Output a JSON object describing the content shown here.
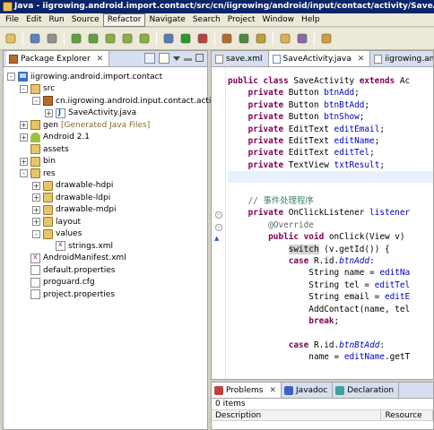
{
  "window": {
    "title": "Java - iigrowing.android.import.contact/src/cn/iigrowing/android/input/contact/activity/SaveActivity.java"
  },
  "menu": [
    "File",
    "Edit",
    "Run",
    "Source",
    "Refactor",
    "Navigate",
    "Search",
    "Project",
    "Window",
    "Help"
  ],
  "toolbar_icons": [
    "new-icon",
    "save-icon",
    "print-icon",
    "sdk-manager-icon",
    "avd-manager-icon",
    "android-project-icon",
    "android-test-icon",
    "android-xml-icon",
    "debug-icon",
    "run-icon",
    "external-tools-icon",
    "new-java-package-icon",
    "new-java-class-icon",
    "open-type-icon",
    "search-icon",
    "annotation-icon",
    "perspective-icon"
  ],
  "package_explorer": {
    "title": "Package Explorer",
    "items": [
      {
        "label": "iigrowing.android.import.contact",
        "icon": "project-icon",
        "indent": 0,
        "toggle": "-"
      },
      {
        "label": "src",
        "icon": "source-folder-icon",
        "indent": 1,
        "toggle": "-"
      },
      {
        "label": "cn.iigrowing.android.input.contact.activity",
        "icon": "package-icon",
        "indent": 2,
        "toggle": "-"
      },
      {
        "label": "SaveActivity.java",
        "icon": "java-file-icon",
        "indent": 3,
        "toggle": "+"
      },
      {
        "label": "gen",
        "icon": "source-folder-icon",
        "indent": 1,
        "toggle": "+",
        "suffix": "[Generated Java Files]"
      },
      {
        "label": "Android 2.1",
        "icon": "android-library-icon",
        "indent": 1,
        "toggle": "+"
      },
      {
        "label": "assets",
        "icon": "folder-icon",
        "indent": 1,
        "toggle": ""
      },
      {
        "label": "bin",
        "icon": "folder-icon",
        "indent": 1,
        "toggle": "+"
      },
      {
        "label": "res",
        "icon": "folder-icon",
        "indent": 1,
        "toggle": "-"
      },
      {
        "label": "drawable-hdpi",
        "icon": "folder-icon",
        "indent": 2,
        "toggle": "+"
      },
      {
        "label": "drawable-ldpi",
        "icon": "folder-icon",
        "indent": 2,
        "toggle": "+"
      },
      {
        "label": "drawable-mdpi",
        "icon": "folder-icon",
        "indent": 2,
        "toggle": "+"
      },
      {
        "label": "layout",
        "icon": "folder-icon",
        "indent": 2,
        "toggle": "+"
      },
      {
        "label": "values",
        "icon": "folder-icon",
        "indent": 2,
        "toggle": "-"
      },
      {
        "label": "strings.xml",
        "icon": "xml-file-icon",
        "indent": 3,
        "toggle": ""
      },
      {
        "label": "AndroidManifest.xml",
        "icon": "xml-file-icon",
        "indent": 1,
        "toggle": ""
      },
      {
        "label": "default.properties",
        "icon": "file-icon",
        "indent": 1,
        "toggle": ""
      },
      {
        "label": "proguard.cfg",
        "icon": "file-icon",
        "indent": 1,
        "toggle": ""
      },
      {
        "label": "project.properties",
        "icon": "file-icon",
        "indent": 1,
        "toggle": ""
      }
    ]
  },
  "editor": {
    "tabs": [
      {
        "label": "save.xml",
        "active": false
      },
      {
        "label": "SaveActivity.java",
        "active": true
      },
      {
        "label": "iigrowing.androi",
        "active": false
      }
    ],
    "code_lines": [
      [
        [
          "kw",
          "public class "
        ],
        [
          "t",
          "SaveActivity "
        ],
        [
          "kw",
          "extends "
        ],
        [
          "t",
          "Ac"
        ]
      ],
      [
        [
          "t",
          "    "
        ],
        [
          "kw",
          "private "
        ],
        [
          "t",
          "Button "
        ],
        [
          "fld",
          "btnAdd"
        ],
        [
          "t",
          ";"
        ]
      ],
      [
        [
          "t",
          "    "
        ],
        [
          "kw",
          "private "
        ],
        [
          "t",
          "Button "
        ],
        [
          "fld",
          "btnBtAdd"
        ],
        [
          "t",
          ";"
        ]
      ],
      [
        [
          "t",
          "    "
        ],
        [
          "kw",
          "private "
        ],
        [
          "t",
          "Button "
        ],
        [
          "fld",
          "btnShow"
        ],
        [
          "t",
          ";"
        ]
      ],
      [
        [
          "t",
          "    "
        ],
        [
          "kw",
          "private "
        ],
        [
          "t",
          "EditText "
        ],
        [
          "fld",
          "editEmail"
        ],
        [
          "t",
          ";"
        ]
      ],
      [
        [
          "t",
          "    "
        ],
        [
          "kw",
          "private "
        ],
        [
          "t",
          "EditText "
        ],
        [
          "fld",
          "editName"
        ],
        [
          "t",
          ";"
        ]
      ],
      [
        [
          "t",
          "    "
        ],
        [
          "kw",
          "private "
        ],
        [
          "t",
          "EditText "
        ],
        [
          "fld",
          "editTel"
        ],
        [
          "t",
          ";"
        ]
      ],
      [
        [
          "t",
          "    "
        ],
        [
          "kw",
          "private "
        ],
        [
          "t",
          "TextView "
        ],
        [
          "fld",
          "txtResult"
        ],
        [
          "t",
          ";"
        ]
      ],
      [
        [
          "t",
          ""
        ]
      ],
      [
        [
          "t",
          ""
        ]
      ],
      [
        [
          "t",
          "    "
        ],
        [
          "cm",
          "// 事件处理程序"
        ]
      ],
      [
        [
          "t",
          "    "
        ],
        [
          "kw",
          "private "
        ],
        [
          "t",
          "OnClickListener "
        ],
        [
          "fld",
          "listener"
        ]
      ],
      [
        [
          "t",
          "        "
        ],
        [
          "an",
          "@Override"
        ]
      ],
      [
        [
          "t",
          "        "
        ],
        [
          "kw",
          "public void "
        ],
        [
          "t",
          "onClick(View v)"
        ]
      ],
      [
        [
          "t",
          "            "
        ],
        [
          "sw",
          "switch"
        ],
        [
          "t",
          " (v.getId()) {"
        ]
      ],
      [
        [
          "t",
          "            "
        ],
        [
          "kw",
          "case "
        ],
        [
          "t",
          "R.id."
        ],
        [
          "sfld",
          "btnAdd"
        ],
        [
          "t",
          ":"
        ]
      ],
      [
        [
          "t",
          "                String name = "
        ],
        [
          "fld",
          "editNa"
        ]
      ],
      [
        [
          "t",
          "                String tel = "
        ],
        [
          "fld",
          "editTel"
        ]
      ],
      [
        [
          "t",
          "                String email = "
        ],
        [
          "fld",
          "editE"
        ]
      ],
      [
        [
          "t",
          "                AddContact(name, tel"
        ]
      ],
      [
        [
          "t",
          "                "
        ],
        [
          "kw",
          "break"
        ],
        [
          "t",
          ";"
        ]
      ],
      [
        [
          "t",
          ""
        ]
      ],
      [
        [
          "t",
          "            "
        ],
        [
          "kw",
          "case "
        ],
        [
          "t",
          "R.id."
        ],
        [
          "sfld",
          "btnBtAdd"
        ],
        [
          "t",
          ":"
        ]
      ],
      [
        [
          "t",
          "                name = "
        ],
        [
          "fld",
          "editName"
        ],
        [
          "t",
          ".getT"
        ]
      ]
    ]
  },
  "problems": {
    "tabs": [
      {
        "label": "Problems",
        "icon": "problems-icon",
        "active": true
      },
      {
        "label": "Javadoc",
        "icon": "javadoc-icon",
        "active": false
      },
      {
        "label": "Declaration",
        "icon": "declaration-icon",
        "active": false
      }
    ],
    "count": "0 items",
    "columns": [
      "Description",
      "Resource"
    ]
  }
}
